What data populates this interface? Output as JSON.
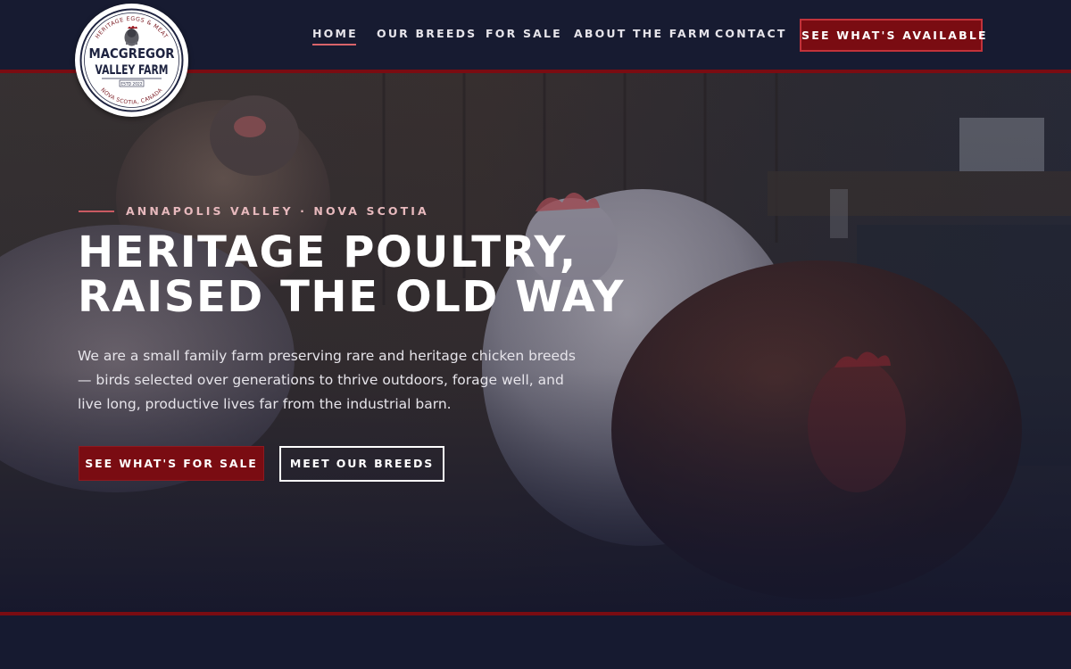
{
  "brand": {
    "name_line1": "MACGREGOR",
    "name_line2": "VALLEY FARM",
    "tagline": "HERITAGE EGGS & MEAT",
    "established": "ESTD 2022",
    "location": "NOVA SCOTIA, CANADA",
    "icon": "chicken-icon"
  },
  "nav": {
    "items": [
      {
        "label": "HOME",
        "active": true
      },
      {
        "label": "OUR BREEDS",
        "active": false
      },
      {
        "label": "FOR SALE",
        "active": false
      },
      {
        "label": "ABOUT THE FARM",
        "active": false
      },
      {
        "label": "CONTACT",
        "active": false
      }
    ],
    "cta_label": "SEE WHAT'S AVAILABLE"
  },
  "hero": {
    "eyebrow": "ANNAPOLIS VALLEY · NOVA SCOTIA",
    "title_line1": "HERITAGE POULTRY,",
    "title_line2": "RAISED THE OLD WAY",
    "body": "We are a small family farm preserving rare and heritage chicken breeds — birds selected over generations to thrive outdoors, forage well, and live long, productive lives far from the industrial barn.",
    "primary_button": "SEE WHAT'S FOR SALE",
    "secondary_button": "MEET OUR BREEDS",
    "background_image": "chickens-in-barn-photo"
  },
  "colors": {
    "navy": "#171b31",
    "crimson": "#7a0c12",
    "accent_pink": "#d9646a",
    "eyebrow_text": "#e7b9bd",
    "white": "#ffffff"
  }
}
